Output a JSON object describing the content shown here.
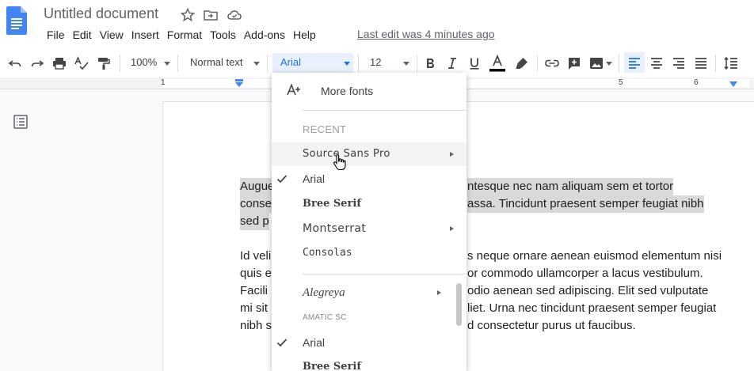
{
  "header": {
    "title": "Untitled document",
    "menus": [
      "File",
      "Edit",
      "View",
      "Insert",
      "Format",
      "Tools",
      "Add-ons",
      "Help"
    ],
    "last_edit": "Last edit was 4 minutes ago"
  },
  "toolbar": {
    "zoom": "100%",
    "style": "Normal text",
    "font": "Arial",
    "font_size": "12"
  },
  "ruler": {
    "numbers": [
      "1",
      "5",
      "6"
    ]
  },
  "font_menu": {
    "more_fonts": "More fonts",
    "recent_header": "RECENT",
    "items": [
      {
        "label": "Source Sans Pro",
        "submenu": true,
        "checked": false
      },
      {
        "label": "Arial",
        "submenu": false,
        "checked": true
      },
      {
        "label": "Bree Serif",
        "submenu": false,
        "checked": false
      },
      {
        "label": "Montserrat",
        "submenu": true,
        "checked": false
      },
      {
        "label": "Consolas",
        "submenu": false,
        "checked": false
      },
      {
        "label": "Alegreya",
        "submenu": true,
        "checked": false
      },
      {
        "label": "AMATIC SC",
        "submenu": false,
        "checked": false
      },
      {
        "label": "Arial",
        "submenu": false,
        "checked": true
      },
      {
        "label": "Bree Serif",
        "submenu": false,
        "checked": false
      }
    ]
  },
  "document": {
    "lines": [
      {
        "left": "Augue",
        "right": "ntesque nec nam aliquam sem et tortor",
        "highlight": true
      },
      {
        "left": "conse",
        "right": "assa. Tincidunt praesent semper feugiat nibh",
        "highlight": true
      },
      {
        "left": "sed p",
        "right": "",
        "highlight": true
      },
      {
        "left": "Id veli",
        "right": "s neque ornare aenean euismod elementum nisi",
        "highlight": false
      },
      {
        "left": "quis e",
        "right": "or commodo ullamcorper a lacus vestibulum.",
        "highlight": false
      },
      {
        "left": "Facili",
        "right": "odio aenean sed adipiscing. Elit sed vulputate",
        "highlight": false
      },
      {
        "left": "mi sit",
        "right": "liet. Urna nec tincidunt praesent semper feugiat",
        "highlight": false
      },
      {
        "left": "nibh s",
        "right": "d consectetur purus ut faucibus.",
        "highlight": false
      }
    ]
  },
  "colors": {
    "accent": "#1a73e8",
    "font_highlight": "#e8f0fe",
    "selection": "#d9d9d9"
  }
}
